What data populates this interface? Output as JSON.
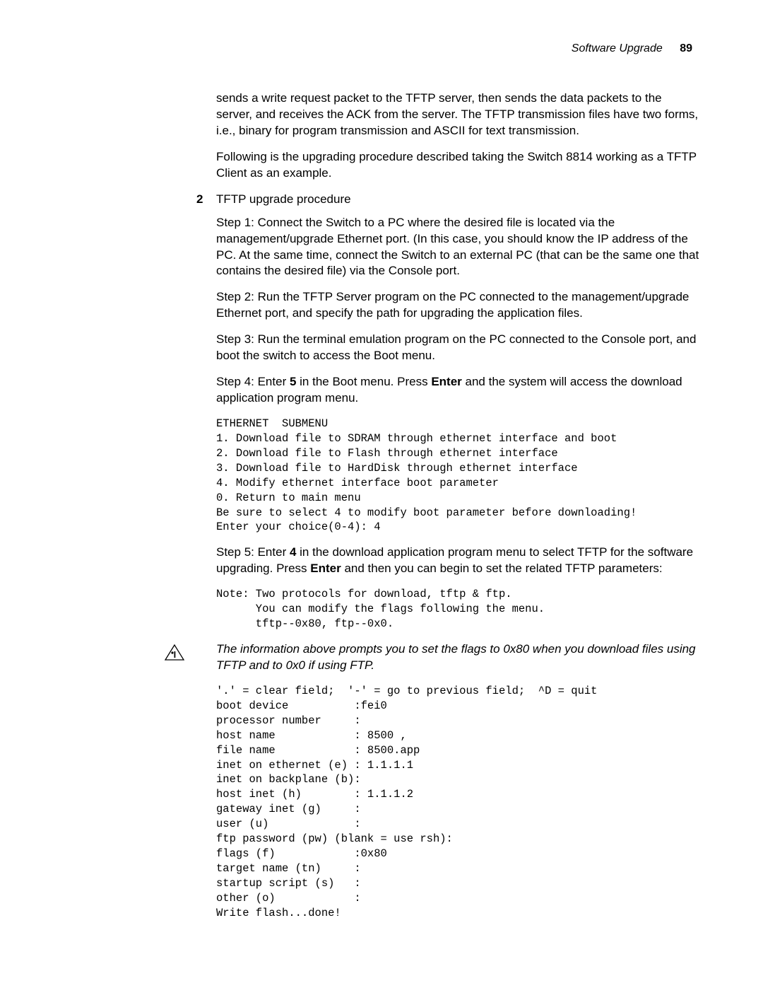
{
  "header": {
    "section": "Software Upgrade",
    "page": "89"
  },
  "p1": "sends a write request packet to the TFTP server, then sends the data packets to the server, and receives the ACK from the server. The TFTP transmission files have two forms, i.e., binary for program transmission and ASCII for text transmission.",
  "p2": "Following is the upgrading procedure described taking the Switch 8814 working as a TFTP Client as an example.",
  "item2": {
    "num": "2",
    "title": "TFTP upgrade procedure"
  },
  "step1": "Step 1: Connect the Switch to a PC where the desired file is located via the management/upgrade Ethernet port. (In this case, you should know the IP address of the PC. At the same time, connect the Switch to an external PC (that can be the same one that contains the desired file) via the Console port.",
  "step2": "Step 2: Run the TFTP Server program on the PC connected to the management/upgrade Ethernet port, and specify the path for upgrading the application files.",
  "step3": "Step 3: Run the terminal emulation program on the PC connected to the Console port, and boot the switch to access the Boot menu.",
  "step4": {
    "pre": "Step 4: Enter ",
    "b1": "5",
    "mid": " in the Boot menu. Press ",
    "b2": "Enter",
    "post": " and the system will access the download application program menu."
  },
  "code1": "ETHERNET  SUBMENU\n1. Download file to SDRAM through ethernet interface and boot\n2. Download file to Flash through ethernet interface\n3. Download file to HardDisk through ethernet interface\n4. Modify ethernet interface boot parameter\n0. Return to main menu\nBe sure to select 4 to modify boot parameter before downloading!\nEnter your choice(0-4): 4",
  "step5": {
    "pre": "Step 5: Enter ",
    "b1": "4",
    "mid": " in the download application program menu to select TFTP for the software upgrading. Press ",
    "b2": "Enter",
    "post": " and then you can begin to set the related TFTP parameters:"
  },
  "code2": "Note: Two protocols for download, tftp & ftp.\n      You can modify the flags following the menu.\n      tftp--0x80, ftp--0x0.",
  "note": " The information above prompts you to set the flags to 0x80 when you download files using TFTP and to 0x0 if using FTP.",
  "code3": "'.' = clear field;  '-' = go to previous field;  ^D = quit\nboot device          :fei0\nprocessor number     :\nhost name            : 8500 ,\nfile name            : 8500.app\ninet on ethernet (e) : 1.1.1.1\ninet on backplane (b):\nhost inet (h)        : 1.1.1.2\ngateway inet (g)     :\nuser (u)             :\nftp password (pw) (blank = use rsh):\nflags (f)            :0x80\ntarget name (tn)     :\nstartup script (s)   :\nother (o)            :\nWrite flash...done!"
}
